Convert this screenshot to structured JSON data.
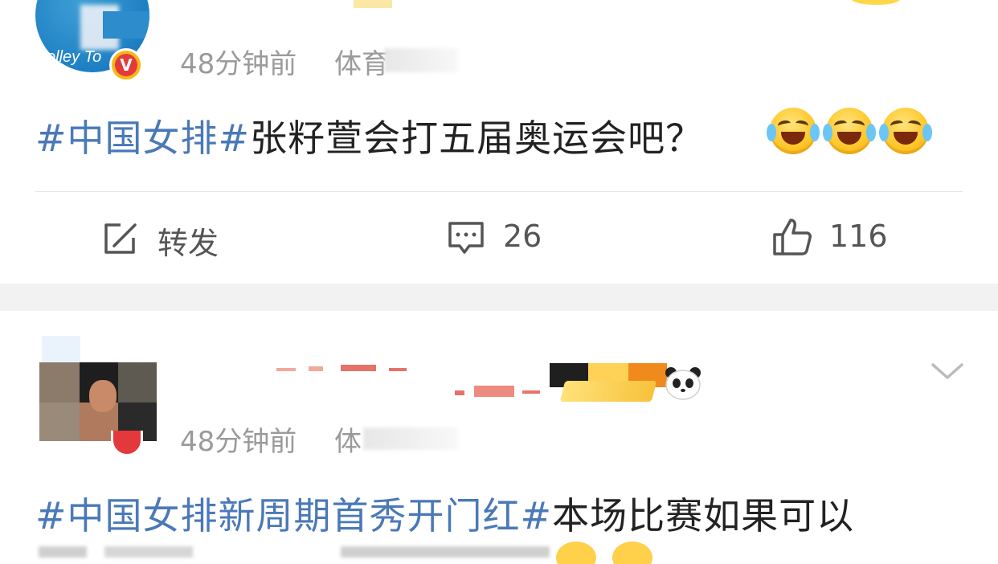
{
  "post1": {
    "time": "48分钟前",
    "source_fragment": "体育",
    "topic": "#中国女排#",
    "text": "张籽萱会打五届奥运会吧？",
    "emojis": [
      "laugh-cry-emoji",
      "laugh-cry-emoji",
      "laugh-cry-emoji"
    ],
    "avatar_text": "olley To",
    "actions": {
      "repost_label": "转发",
      "comment_count": "26",
      "like_count": "116"
    }
  },
  "post2": {
    "time": "48分钟前",
    "source_fragment": "体",
    "topic": "#中国女排新周期首秀开门红#",
    "text": "本场比赛如果可以"
  },
  "icons": {
    "repost": "edit-share-icon",
    "comment": "comment-icon",
    "like": "thumbs-up-icon",
    "more": "chevron-down-icon",
    "verified": "verified-v-icon",
    "panda": "panda-icon"
  },
  "colors": {
    "topic_link": "#4a79b7",
    "meta_text": "#9a9a9a",
    "body_text": "#222222",
    "divider": "#e6e6e6",
    "section_gap": "#f2f2f2"
  }
}
